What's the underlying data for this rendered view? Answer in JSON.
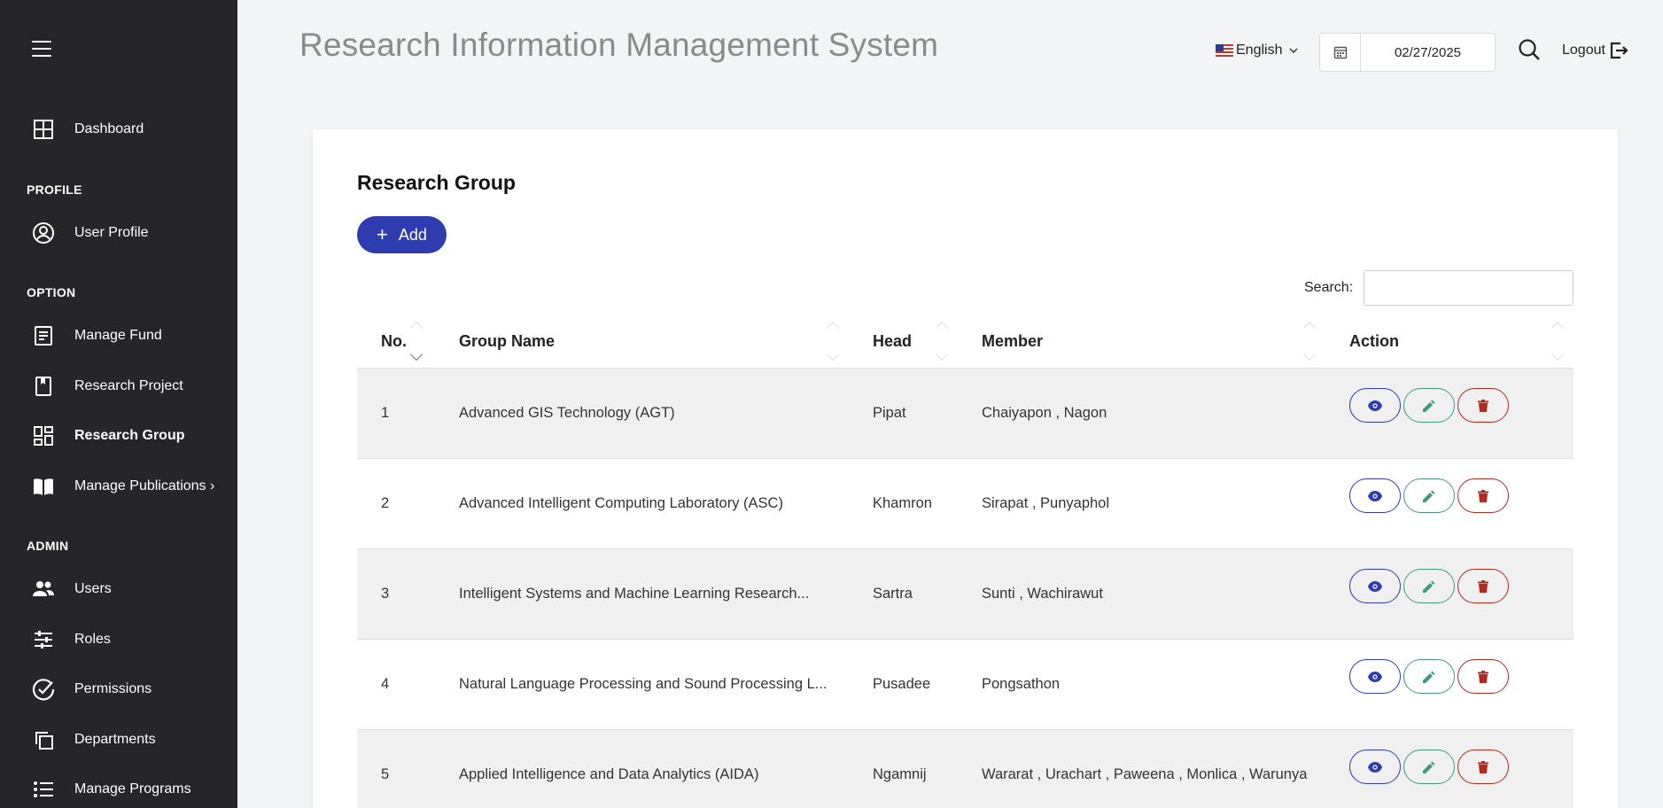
{
  "sidebar": {
    "dashboard": "Dashboard",
    "section_profile": "PROFILE",
    "user_profile": "User Profile",
    "section_option": "OPTION",
    "manage_fund": "Manage Fund",
    "research_project": "Research Project",
    "research_group": "Research Group",
    "manage_publications": "Manage Publications ›",
    "section_admin": "ADMIN",
    "users": "Users",
    "roles": "Roles",
    "permissions": "Permissions",
    "departments": "Departments",
    "manage_programs": "Manage Programs"
  },
  "header": {
    "title": "Research Information Management System",
    "language": "English",
    "date": "02/27/2025",
    "logout": "Logout"
  },
  "main": {
    "card_title": "Research Group",
    "add_label": "Add",
    "search_label": "Search:",
    "columns": [
      "No.",
      "Group Name",
      "Head",
      "Member",
      "Action"
    ],
    "rows": [
      {
        "no": "1",
        "name": "Advanced GIS Technology (AGT)",
        "head": "Pipat",
        "member": "Chaiyapon , Nagon"
      },
      {
        "no": "2",
        "name": "Advanced Intelligent Computing Laboratory (ASC)",
        "head": "Khamron",
        "member": "Sirapat , Punyaphol"
      },
      {
        "no": "3",
        "name": "Intelligent Systems and Machine Learning Research...",
        "head": "Sartra",
        "member": "Sunti , Wachirawut"
      },
      {
        "no": "4",
        "name": "Natural Language Processing and Sound Processing L...",
        "head": "Pusadee",
        "member": "Pongsathon"
      },
      {
        "no": "5",
        "name": "Applied Intelligence and Data Analytics (AIDA)",
        "head": "Ngamnij",
        "member": "Wararat , Urachart , Paweena , Monlica , Warunya"
      }
    ]
  },
  "colors": {
    "sidebar_bg": "#25252a",
    "primary": "#2d3cae",
    "edit": "#3f9a7a",
    "delete": "#b02a1e"
  }
}
